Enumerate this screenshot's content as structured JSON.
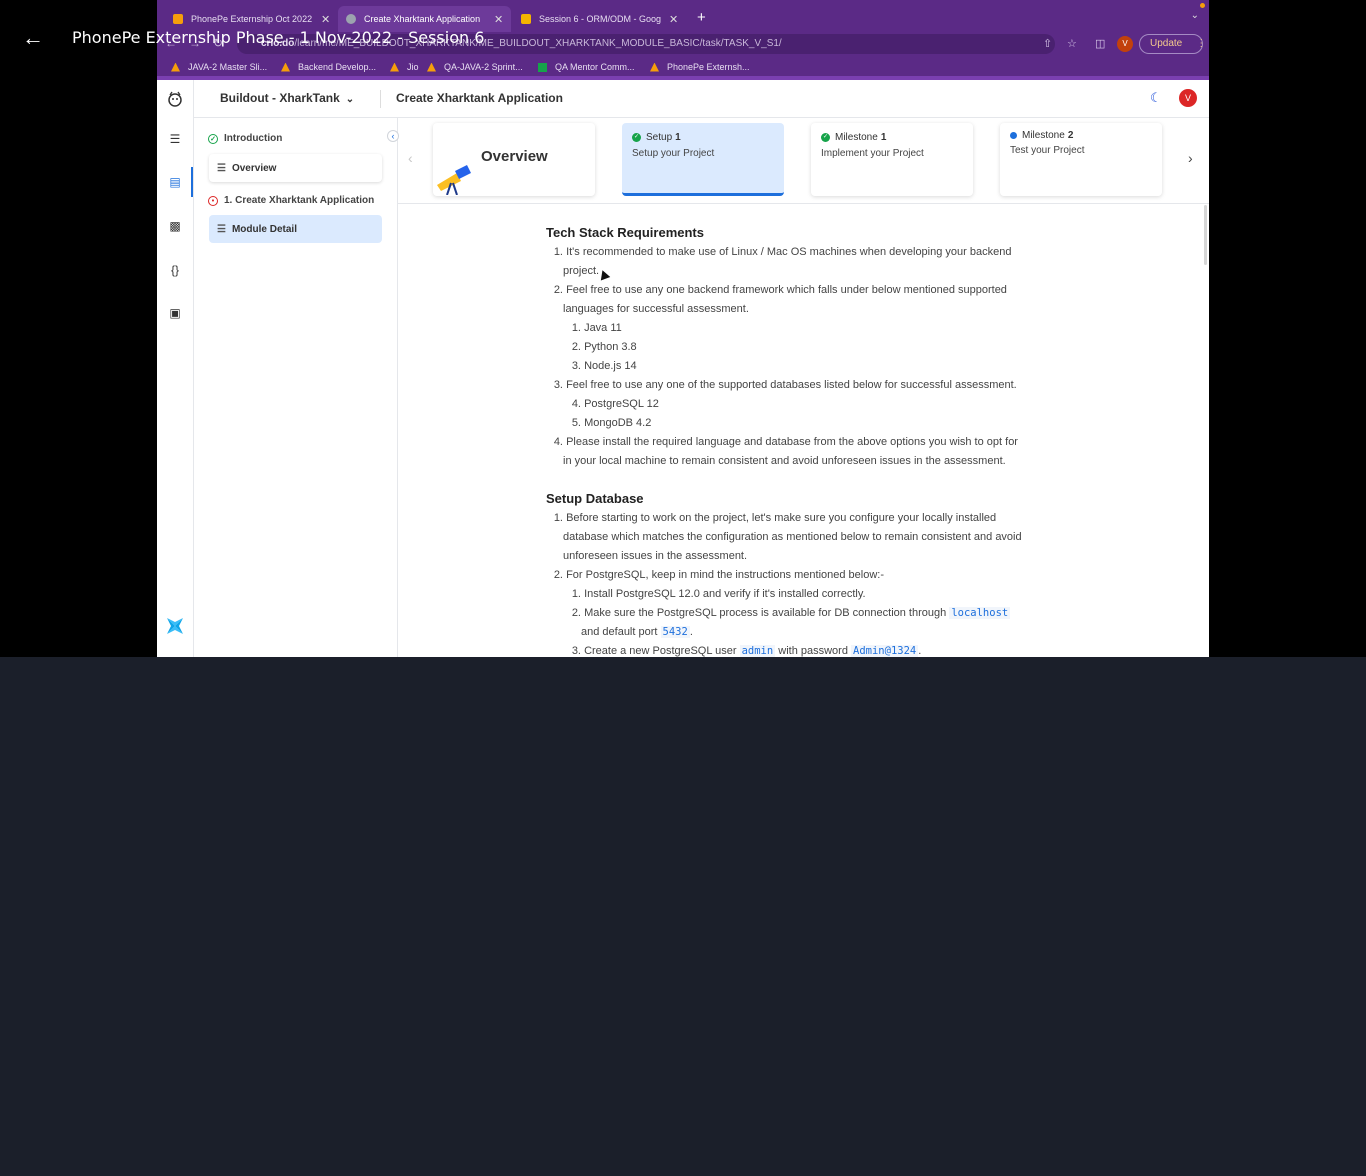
{
  "player": {
    "title": "PhonePe Externship Phase - 1 Nov-2022 - Session 6",
    "back_icon": "arrow-left-icon"
  },
  "browser": {
    "tabs": [
      {
        "label": "PhonePe Externship Oct 2022",
        "active": false,
        "color": "#f59e0b"
      },
      {
        "label": "Create Xharktank Application",
        "active": true,
        "color": "#9ca3af"
      },
      {
        "label": "Session 6 - ORM/ODM - Goog",
        "active": false,
        "color": "#f4b400"
      }
    ],
    "url_host": "crio.do",
    "url_path": "/learn/me/ME_BUILDOUT_XHARKTANK/ME_BUILDOUT_XHARKTANK_MODULE_BASIC/task/TASK_V_S1/",
    "profile_initial": "V",
    "update_label": "Update",
    "bookmarks": [
      "JAVA-2 Master Sli...",
      "Backend Develop...",
      "Jio",
      "QA-JAVA-2 Sprint...",
      "QA Mentor Comm...",
      "PhonePe Externsh..."
    ]
  },
  "app": {
    "module_name": "Buildout - XharkTank",
    "page_title": "Create Xharktank Application",
    "user_initial": "V",
    "sidenav": {
      "section1": "Introduction",
      "item1": "Overview",
      "section2": "1. Create Xharktank Application",
      "item2": "Module Detail"
    },
    "cards": {
      "overview": "Overview",
      "setup_label": "Setup",
      "setup_num": "1",
      "setup_sub": "Setup your Project",
      "m1_label": "Milestone",
      "m1_num": "1",
      "m1_sub": "Implement your Project",
      "m2_label": "Milestone",
      "m2_num": "2",
      "m2_sub": "Test your Project"
    },
    "content": {
      "h1": "Tech Stack Requirements",
      "l1a": "It's recommended to make use of Linux / Mac OS machines when developing your backend",
      "l1b": "project.",
      "l2a": "Feel free to use any one backend framework which falls under below mentioned supported",
      "l2b": "languages for successful assessment.",
      "s1": "Java 11",
      "s2": "Python 3.8",
      "s3": "Node.js 14",
      "l3": "Feel free to use any one of the supported databases listed below for successful assessment.",
      "s4": "PostgreSQL 12",
      "s5": "MongoDB 4.2",
      "l4a": "Please install the required language and database from the above options you wish to opt for",
      "l4b": "in your local machine to remain consistent and avoid unforeseen issues in the assessment.",
      "h2": "Setup Database",
      "d1a": "Before starting to work on the project, let's make sure you configure your locally installed",
      "d1b": "database which matches the configuration as mentioned below to remain consistent and avoid",
      "d1c": "unforeseen issues in the assessment.",
      "d2": "For PostgreSQL, keep in mind the instructions mentioned below:-",
      "p1": "Install PostgreSQL 12.0 and verify if it's installed correctly.",
      "p2a": "Make sure the PostgreSQL process is available for DB connection through",
      "p2code": "localhost",
      "p2b": "and default port",
      "p2port": "5432",
      "p3a": "Create a new PostgreSQL user",
      "p3user": "admin",
      "p3b": "with password",
      "p3pass": "Admin@1324"
    }
  },
  "colors": {
    "chrome": "#5b2a86",
    "accent": "#1d6fdc",
    "success": "#16a34a",
    "stage_bg": "#1b1f2a"
  }
}
